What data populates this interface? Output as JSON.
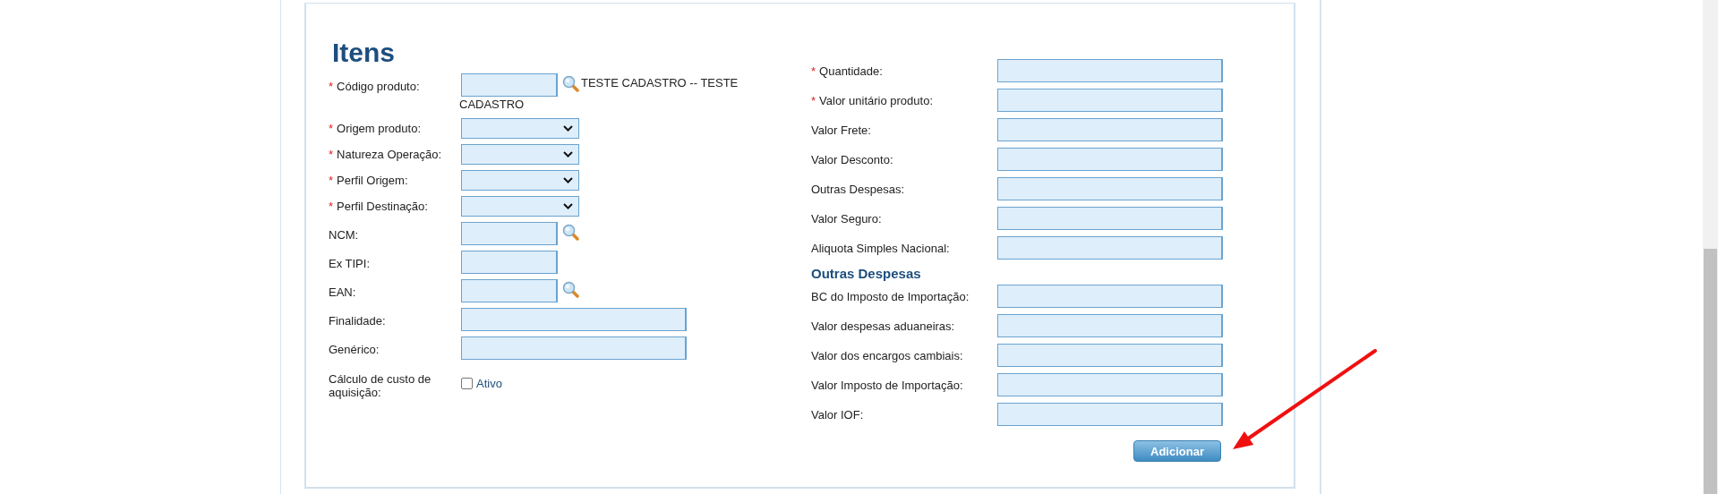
{
  "title": "Itens",
  "left_fields": [
    {
      "label": "Código produto:",
      "required_mark": "*",
      "kind": "text",
      "wide": false,
      "search": true,
      "lookup_lines": [
        "TESTE CADASTRO -- TESTE",
        "CADASTRO"
      ]
    },
    {
      "label": "Origem produto:",
      "required_mark": "*",
      "kind": "select"
    },
    {
      "label": "Natureza Operação:",
      "required_mark": "*",
      "kind": "select"
    },
    {
      "label": "Perfil Origem:",
      "required_mark": "*",
      "kind": "select"
    },
    {
      "label": "Perfil Destinação:",
      "required_mark": "*",
      "kind": "select"
    },
    {
      "label": "NCM:",
      "kind": "text",
      "wide": false,
      "search": true
    },
    {
      "label": "Ex TIPI:",
      "kind": "text",
      "wide": false,
      "search": false
    },
    {
      "label": "EAN:",
      "kind": "text",
      "wide": false,
      "search": true
    },
    {
      "label": "Finalidade:",
      "kind": "text",
      "wide": true,
      "search": false
    },
    {
      "label": "Genérico:",
      "kind": "text",
      "wide": true,
      "search": false
    },
    {
      "label": "Cálculo de custo de aquisição:",
      "kind": "checkbox",
      "option": "Ativo",
      "checked": false
    }
  ],
  "right_fields": [
    {
      "label": "Quantidade:",
      "required_mark": "*"
    },
    {
      "label": "Valor unitário produto:",
      "required_mark": "*"
    },
    {
      "label": "Valor Frete:"
    },
    {
      "label": "Valor Desconto:"
    },
    {
      "label": "Outras Despesas:"
    },
    {
      "label": "Valor Seguro:"
    },
    {
      "label": "Aliquota Simples Nacional:"
    }
  ],
  "section": {
    "title": "Outras Despesas",
    "fields": [
      {
        "label": "BC do Imposto de Importação:"
      },
      {
        "label": "Valor despesas aduaneiras:"
      },
      {
        "label": "Valor dos encargos cambiais:"
      },
      {
        "label": "Valor Imposto de Importação:"
      },
      {
        "label": "Valor IOF:"
      }
    ]
  },
  "button": "Adicionar"
}
